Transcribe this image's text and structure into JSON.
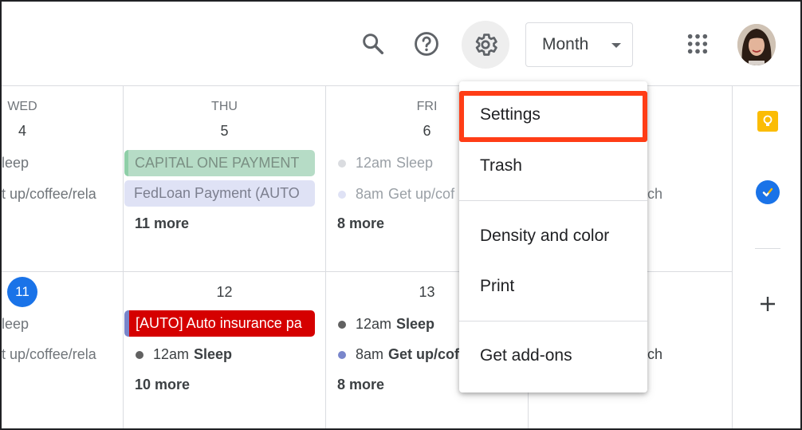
{
  "header": {
    "view_select": "Month"
  },
  "icons": {
    "search": "search-icon",
    "help": "help-icon",
    "settings": "gear-icon",
    "apps": "apps-grid-icon"
  },
  "days": [
    {
      "dow": "WED",
      "num": "4"
    },
    {
      "dow": "THU",
      "num": "5"
    },
    {
      "dow": "FRI",
      "num": "6"
    }
  ],
  "week1": {
    "wed": {
      "ev1": "leep",
      "ev2": "t up/coffee/rela"
    },
    "thu": {
      "chip1": "CAPITAL ONE PAYMENT",
      "chip2": "FedLoan Payment (AUTO",
      "more": "11 more"
    },
    "fri": {
      "ev1_time": "12am",
      "ev1_title": "Sleep",
      "ev2_time": "8am",
      "ev2_title": "Get up/cof",
      "more": "8 more"
    },
    "sat": {
      "partial": "ch"
    }
  },
  "week2": {
    "wed": {
      "num": "11",
      "ev1": "leep",
      "ev2": "t up/coffee/rela"
    },
    "thu": {
      "num": "12",
      "chip1": "[AUTO] Auto insurance pa",
      "ev1_time": "12am",
      "ev1_title": "Sleep",
      "more": "10 more"
    },
    "fri": {
      "num": "13",
      "ev1_time": "12am",
      "ev1_title": "Sleep",
      "ev2_time": "8am",
      "ev2_title": "Get up/cof",
      "more": "8 more"
    },
    "sat": {
      "partial": "ch"
    }
  },
  "menu": {
    "items": [
      "Settings",
      "Trash",
      "Density and color",
      "Print",
      "Get add-ons"
    ]
  },
  "colors": {
    "today": "#1a73e8",
    "highlight": "#ff3d16",
    "red_event": "#d50000",
    "green_event": "#b6dcc6",
    "lavender_event": "#dfe2f5"
  }
}
